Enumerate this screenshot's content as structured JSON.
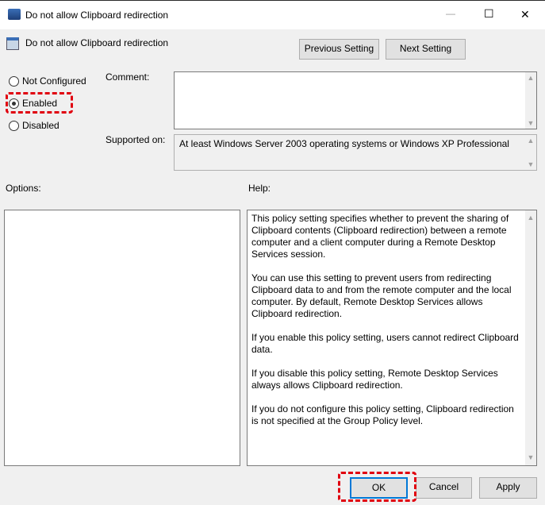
{
  "window": {
    "title": "Do not allow Clipboard redirection",
    "minimize": "—",
    "maximize": "☐",
    "close": "✕"
  },
  "header": {
    "policy_name": "Do not allow Clipboard redirection",
    "previous_label": "Previous Setting",
    "next_label": "Next Setting"
  },
  "state": {
    "options": [
      {
        "label": "Not Configured",
        "selected": false
      },
      {
        "label": "Enabled",
        "selected": true
      },
      {
        "label": "Disabled",
        "selected": false
      }
    ]
  },
  "comment": {
    "label": "Comment:",
    "value": ""
  },
  "supported": {
    "label": "Supported on:",
    "value": "At least Windows Server 2003 operating systems or Windows XP Professional"
  },
  "options_label": "Options:",
  "help_label": "Help:",
  "help": {
    "paragraphs": [
      "This policy setting specifies whether to prevent the sharing of Clipboard contents (Clipboard redirection) between a remote computer and a client computer during a Remote Desktop Services session.",
      "You can use this setting to prevent users from redirecting Clipboard data to and from the remote computer and the local computer. By default, Remote Desktop Services allows Clipboard redirection.",
      "If you enable this policy setting, users cannot redirect Clipboard data.",
      "If you disable this policy setting, Remote Desktop Services always allows Clipboard redirection.",
      "If you do not configure this policy setting, Clipboard redirection is not specified at the Group Policy level."
    ]
  },
  "footer": {
    "ok": "OK",
    "cancel": "Cancel",
    "apply": "Apply"
  },
  "colors": {
    "highlight": "#e0000f",
    "focus": "#0078d7"
  }
}
